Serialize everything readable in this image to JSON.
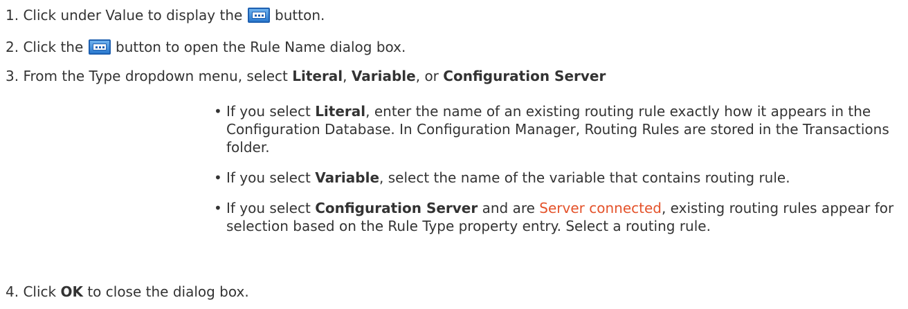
{
  "steps": [
    {
      "number": "1.",
      "text_before": "Click under Value to display the",
      "icon": "ellipsis-button-icon",
      "text_after": "button."
    },
    {
      "number": "2.",
      "text_before": "Click the",
      "icon": "ellipsis-button-icon",
      "text_after": "button to open the Rule Name dialog box."
    },
    {
      "number": "3.",
      "text_before": "From the Type dropdown menu, select",
      "opt1": "Literal",
      "sep1": ",",
      "opt2": "Variable",
      "sep2": ", or",
      "opt3": "Configuration Server"
    },
    {
      "number": "4.",
      "text_before": "Click",
      "bold": "OK",
      "text_after": "to close the dialog box."
    }
  ],
  "bullets": [
    {
      "prefix": "If you select",
      "bold": "Literal",
      "text": ", enter the name of an existing routing rule exactly how it appears in the Configuration Database. In Configuration Manager, Routing Rules are stored in the Transactions folder."
    },
    {
      "prefix": "If you select",
      "bold": "Variable",
      "text": ", select the name of the variable that contains routing rule."
    },
    {
      "prefix": "If you select",
      "bold": "Configuration Server",
      "middle": "and are",
      "link": "Server connected",
      "text": ", existing routing rules appear for selection based on the Rule Type property entry. Select a routing rule."
    }
  ],
  "colors": {
    "text": "#333333",
    "link": "#e4522a",
    "icon_blue": "#2a79cf"
  }
}
